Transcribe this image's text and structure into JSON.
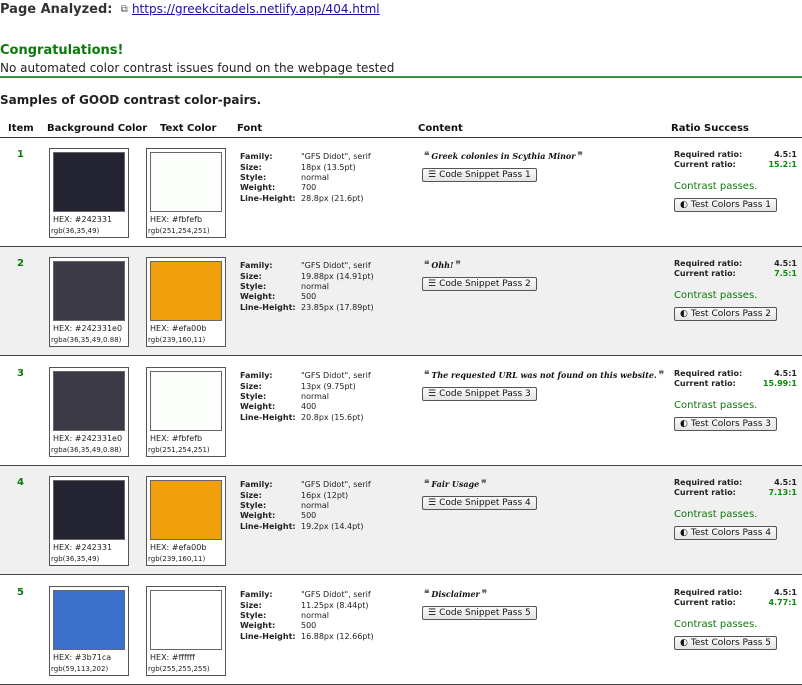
{
  "page": {
    "analyzed_label": "Page Analyzed:",
    "url": "https://greekcitadels.netlify.app/404.html",
    "congrats_title": "Congratulations!",
    "congrats_text": "No automated color contrast issues found on the webpage tested",
    "samples_heading": "Samples of GOOD contrast color-pairs."
  },
  "columns": {
    "item": "Item",
    "background": "Background Color",
    "text": "Text Color",
    "font": "Font",
    "content": "Content",
    "ratio": "Ratio Success"
  },
  "labels": {
    "family": "Family:",
    "size": "Size:",
    "style": "Style:",
    "weight": "Weight:",
    "line_height": "Line-Height:",
    "required": "Required ratio:",
    "current": "Current ratio:",
    "passes": "Contrast passes."
  },
  "colors": {
    "accent_green": "#0a7a0a",
    "link_blue": "#1a0dab",
    "row_alt": "#f0f0f0"
  },
  "rows": [
    {
      "num": "1",
      "bg": {
        "hex": "HEX: #242331",
        "rgb": "rgb(36,35,49)",
        "color": "#242331"
      },
      "fg": {
        "hex": "HEX: #fbfefb",
        "rgb": "rgb(251,254,251)",
        "color": "#fbfefb"
      },
      "font": {
        "family": "\"GFS Didot\", serif",
        "size": "18px (13.5pt)",
        "style": "normal",
        "weight": "700",
        "line_height": "28.8px (21.6pt)"
      },
      "content": "Greek colonies in Scythia Minor",
      "snippet_label": "Code Snippet Pass 1",
      "required": "4.5:1",
      "current": "15.2:1",
      "test_label": "Test Colors Pass 1"
    },
    {
      "num": "2",
      "bg": {
        "hex": "HEX: #242331e0",
        "rgb": "rgba(36,35,49,0.88)",
        "color": "#3b3a46"
      },
      "fg": {
        "hex": "HEX: #efa00b",
        "rgb": "rgb(239,160,11)",
        "color": "#efa00b"
      },
      "font": {
        "family": "\"GFS Didot\", serif",
        "size": "19.88px (14.91pt)",
        "style": "normal",
        "weight": "500",
        "line_height": "23.85px (17.89pt)"
      },
      "content": "Ohh!",
      "snippet_label": "Code Snippet Pass 2",
      "required": "4.5:1",
      "current": "7.5:1",
      "test_label": "Test Colors Pass 2"
    },
    {
      "num": "3",
      "bg": {
        "hex": "HEX: #242331e0",
        "rgb": "rgba(36,35,49,0.88)",
        "color": "#3b3a46"
      },
      "fg": {
        "hex": "HEX: #fbfefb",
        "rgb": "rgb(251,254,251)",
        "color": "#fbfefb"
      },
      "font": {
        "family": "\"GFS Didot\", serif",
        "size": "13px (9.75pt)",
        "style": "normal",
        "weight": "400",
        "line_height": "20.8px (15.6pt)"
      },
      "content": "The requested URL was not found on this website.",
      "snippet_label": "Code Snippet Pass 3",
      "required": "4.5:1",
      "current": "15.99:1",
      "test_label": "Test Colors Pass 3"
    },
    {
      "num": "4",
      "bg": {
        "hex": "HEX: #242331",
        "rgb": "rgb(36,35,49)",
        "color": "#242331"
      },
      "fg": {
        "hex": "HEX: #efa00b",
        "rgb": "rgb(239,160,11)",
        "color": "#efa00b"
      },
      "font": {
        "family": "\"GFS Didot\", serif",
        "size": "16px (12pt)",
        "style": "normal",
        "weight": "500",
        "line_height": "19.2px (14.4pt)"
      },
      "content": "Fair Usage",
      "snippet_label": "Code Snippet Pass 4",
      "required": "4.5:1",
      "current": "7.13:1",
      "test_label": "Test Colors Pass 4"
    },
    {
      "num": "5",
      "bg": {
        "hex": "HEX: #3b71ca",
        "rgb": "rgb(59,113,202)",
        "color": "#3b71ca"
      },
      "fg": {
        "hex": "HEX: #ffffff",
        "rgb": "rgb(255,255,255)",
        "color": "#ffffff"
      },
      "font": {
        "family": "\"GFS Didot\", serif",
        "size": "11.25px (8.44pt)",
        "style": "normal",
        "weight": "500",
        "line_height": "16.88px (12.66pt)"
      },
      "content": "Disclaimer",
      "snippet_label": "Code Snippet Pass 5",
      "required": "4.5:1",
      "current": "4.77:1",
      "test_label": "Test Colors Pass 5"
    }
  ]
}
